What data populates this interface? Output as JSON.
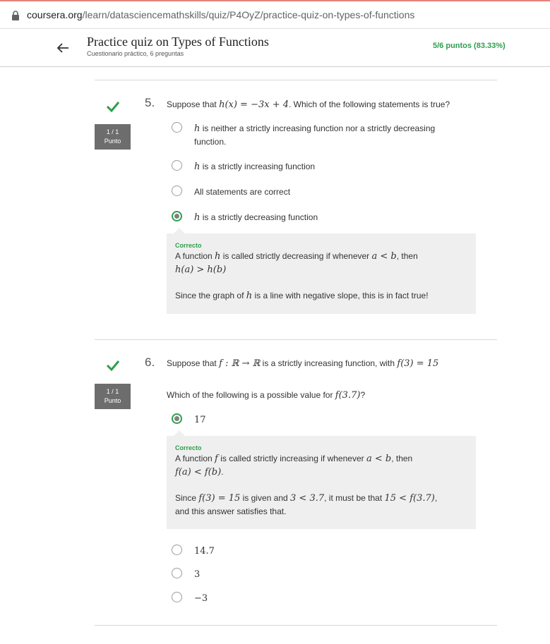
{
  "browser": {
    "url_host": "coursera.org",
    "url_path": "/learn/datasciencemathskills/quiz/P4OyZ/practice-quiz-on-types-of-functions"
  },
  "header": {
    "title": "Practice quiz on Types of Functions",
    "subtitle": "Cuestionario práctico, 6 preguntas",
    "score": "5/6 puntos (83.33%)"
  },
  "questions": [
    {
      "number": "5.",
      "points": "1 / 1",
      "points_label": "Punto",
      "prompt_before": "Suppose that",
      "prompt_math": "h(x) = −3x + 4",
      "prompt_after": ". Which of the following statements is true?",
      "options": [
        {
          "math": "h",
          "text": " is neither a strictly increasing function nor a strictly decreasing",
          "text2": "function."
        },
        {
          "math": "h",
          "text": " is a strictly increasing function"
        },
        {
          "math": "",
          "text": "All statements are correct"
        },
        {
          "math": "h",
          "text": " is a strictly decreasing function"
        }
      ],
      "feedback": {
        "status": "Correcto",
        "l1_a": "A function ",
        "l1_m1": "h",
        "l1_b": " is called strictly decreasing if whenever ",
        "l1_m2": "a < b",
        "l1_c": ", then",
        "l2_m": "h(a) > h(b)",
        "l3_a": "Since the graph of ",
        "l3_m": "h",
        "l3_b": " is a line with negative slope, this is in fact true!"
      }
    },
    {
      "number": "6.",
      "points": "1 / 1",
      "points_label": "Punto",
      "prompt_before": "Suppose that",
      "prompt_math": "f : ℝ → ℝ",
      "prompt_after": "is a strictly increasing function, with",
      "prompt_math2": "f(3) = 15",
      "sub_before": "Which of the following is a possible value for",
      "sub_math": "f(3.7)",
      "sub_after": "?",
      "selected_option": "17",
      "feedback": {
        "status": "Correcto",
        "l1_a": "A function ",
        "l1_m1": "f",
        "l1_b": " is called strictly increasing if whenever ",
        "l1_m2": "a < b",
        "l1_c": ", then",
        "l2_m": "f(a) < f(b)",
        "l2_end": ".",
        "l3_a": "Since ",
        "l3_m1": "f(3) = 15",
        "l3_b": " is given and ",
        "l3_m2": "3 < 3.7",
        "l3_c": ", it must be that ",
        "l3_m3": "15 < f(3.7)",
        "l3_d": ",",
        "l4": "and this answer satisfies that."
      },
      "other_options": [
        "14.7",
        "3",
        "−3"
      ]
    }
  ],
  "colors": {
    "success": "#2e9e4c",
    "points_bg": "#6d6d6d",
    "feedback_bg": "#efefef"
  }
}
